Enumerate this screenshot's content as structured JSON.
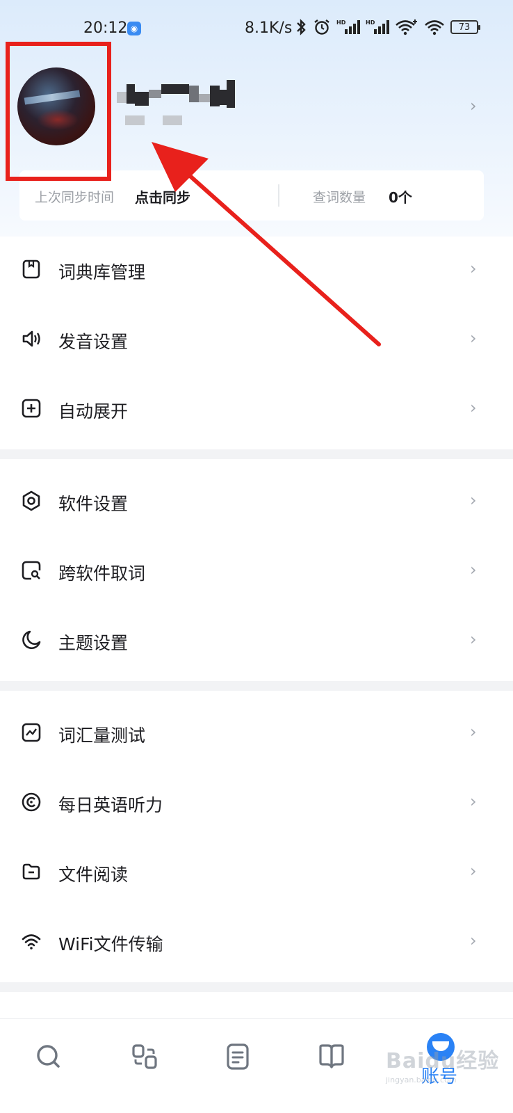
{
  "status_bar": {
    "time": "20:12",
    "network_speed": "8.1K/s",
    "battery": "73",
    "icons": [
      "bluetooth-icon",
      "alarm-icon",
      "hd-signal-icon",
      "hd-signal-icon",
      "wifi-plus-icon",
      "wifi-icon"
    ]
  },
  "profile": {
    "username": "",
    "user_id": ""
  },
  "sync": {
    "last_sync_label": "上次同步时间",
    "last_sync_value": "点击同步",
    "lookup_count_label": "查词数量",
    "lookup_count_value": "0个"
  },
  "menu": {
    "group1": [
      {
        "label": "词典库管理",
        "icon": "dictionary-book-icon"
      },
      {
        "label": "发音设置",
        "icon": "speaker-icon"
      },
      {
        "label": "自动展开",
        "icon": "plus-square-icon"
      }
    ],
    "group2": [
      {
        "label": "软件设置",
        "icon": "settings-hexagon-icon"
      },
      {
        "label": "跨软件取词",
        "icon": "screen-search-icon"
      },
      {
        "label": "主题设置",
        "icon": "moon-icon"
      }
    ],
    "group3": [
      {
        "label": "词汇量测试",
        "icon": "chart-line-icon"
      },
      {
        "label": "每日英语听力",
        "icon": "headphone-circle-icon"
      },
      {
        "label": "文件阅读",
        "icon": "folder-icon"
      },
      {
        "label": "WiFi文件传输",
        "icon": "wifi-icon"
      }
    ]
  },
  "bottom_nav": {
    "items": [
      {
        "icon": "search-icon"
      },
      {
        "icon": "translate-icon"
      },
      {
        "icon": "notes-icon"
      },
      {
        "icon": "book-icon"
      }
    ],
    "account_label": "账号"
  },
  "watermark": {
    "text": "Baidu经验",
    "subtext": "jingyan.baidu.com"
  },
  "colors": {
    "accent": "#2a82f5",
    "highlight_red": "#e8211c",
    "header_bg": "#dcebfb"
  }
}
